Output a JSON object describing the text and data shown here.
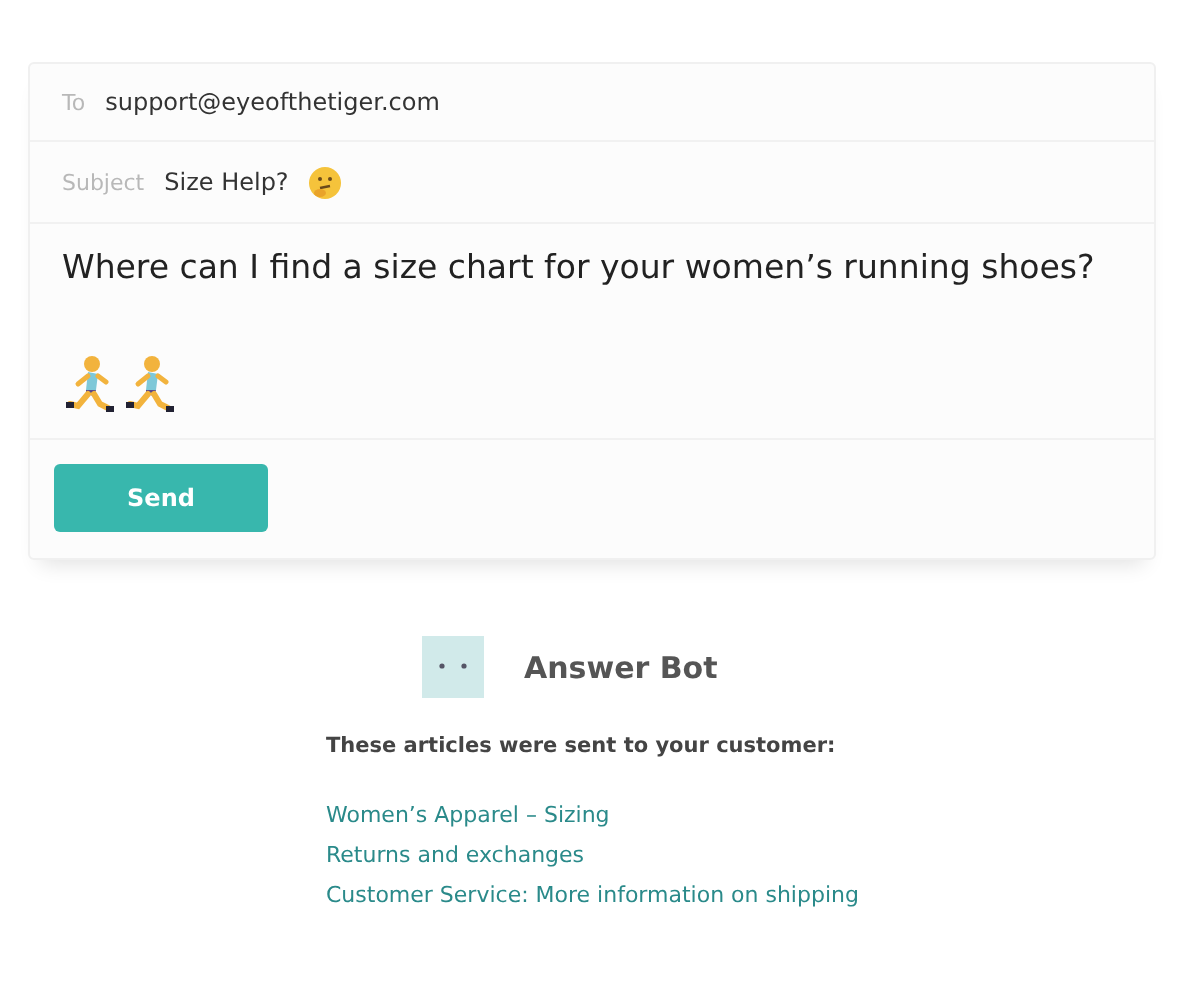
{
  "email": {
    "to_label": "To",
    "to": "support@eyeofthetiger.com",
    "subject_label": "Subject",
    "subject": "Size Help?",
    "body": "Where can I find a size chart for your women’s running shoes?",
    "send_button": "Send"
  },
  "answer_bot": {
    "name": "Answer Bot",
    "intro": "These articles were sent to your customer:",
    "articles": [
      "Women’s Apparel – Sizing",
      "Returns and exchanges",
      "Customer Service: More information on shipping"
    ]
  }
}
